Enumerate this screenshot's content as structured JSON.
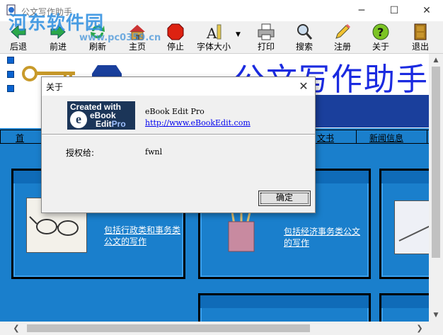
{
  "window": {
    "title": "公文写作助手",
    "watermark": "河东软件园",
    "watermark_url": "www.pc0359.cn",
    "controls": {
      "minimize": "─",
      "maximize": "☐",
      "close": "✕"
    }
  },
  "toolbar": {
    "buttons": [
      {
        "label": "后退",
        "icon": "back-arrow-icon"
      },
      {
        "label": "前进",
        "icon": "forward-arrow-icon"
      },
      {
        "label": "刷新",
        "icon": "refresh-icon"
      },
      {
        "label": "主页",
        "icon": "home-icon"
      },
      {
        "label": "停止",
        "icon": "stop-icon"
      },
      {
        "label": "字体大小",
        "icon": "font-size-icon"
      },
      {
        "label": "打印",
        "icon": "printer-icon"
      },
      {
        "label": "搜索",
        "icon": "magnifier-icon"
      },
      {
        "label": "注册",
        "icon": "pencil-icon"
      },
      {
        "label": "关于",
        "icon": "help-icon"
      },
      {
        "label": "退出",
        "icon": "exit-door-icon"
      }
    ],
    "dropdown_arrow": "▼"
  },
  "content": {
    "banner_title": "公文写作助手",
    "nav": {
      "home": "首",
      "docs": "文书",
      "news": "新闻信息"
    },
    "cards": [
      {
        "text": "包括行政类和事务类公文的写作"
      },
      {
        "text": "包括经济事务类公文的写作"
      }
    ]
  },
  "scrollbars": {
    "up": "▲",
    "down": "▼",
    "left": "❮",
    "right": "❯"
  },
  "about_dialog": {
    "title": "关于",
    "close": "✕",
    "logo": {
      "line1": "Created with",
      "letter": "e",
      "line2": "eBook",
      "line3a": "Edit",
      "line3b": "Pro"
    },
    "product": "eBook Edit Pro",
    "url": "http://www.eBookEdit.com",
    "license_label": "授权给:",
    "license_value": "fwnl",
    "ok_label": "确定"
  },
  "colors": {
    "content_blue": "#1a7fcc",
    "banner_text": "#1a2ae0",
    "link": "#0000ee"
  }
}
